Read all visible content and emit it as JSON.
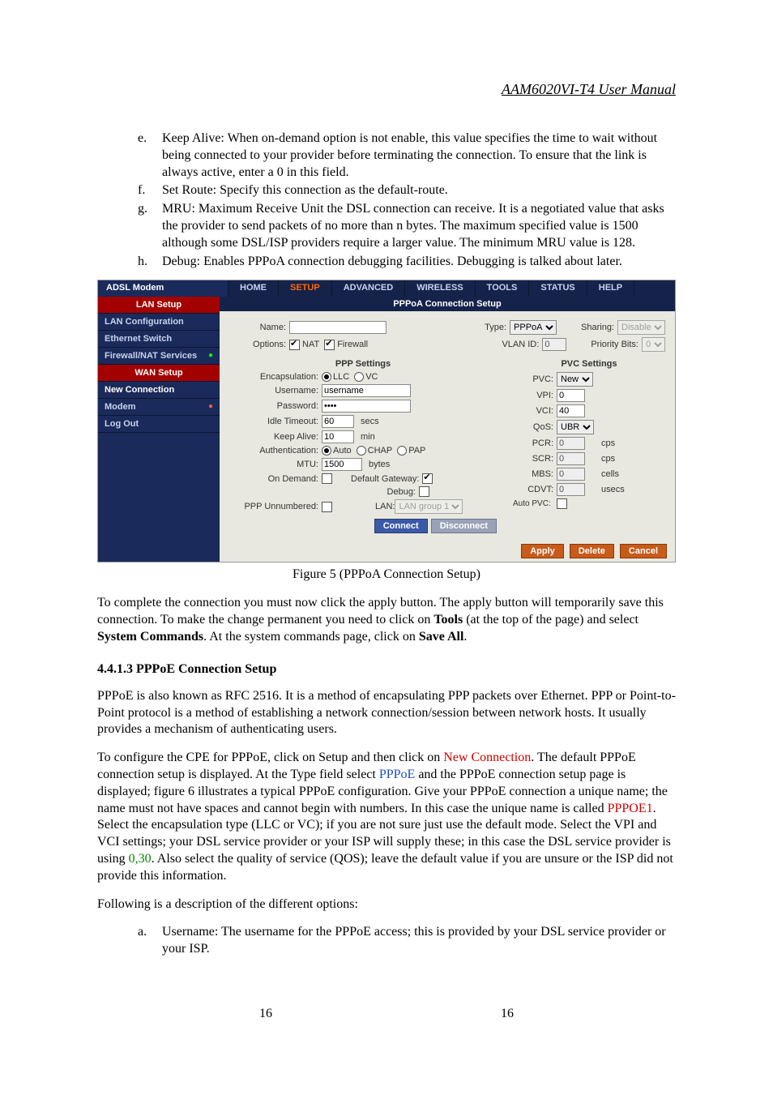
{
  "header": {
    "title": "AAM6020VI-T4 User Manual"
  },
  "list": {
    "e": {
      "marker": "e.",
      "text": "Keep Alive: When on-demand option is not enable, this value specifies the time to wait without being connected to your provider before terminating the connection. To ensure that the link is always active, enter a 0 in this field."
    },
    "f": {
      "marker": "f.",
      "text": "Set Route: Specify this connection as the default-route."
    },
    "g": {
      "marker": "g.",
      "text": "MRU: Maximum Receive Unit the DSL connection can receive. It is a negotiated value that asks the provider to send packets of no more than n bytes. The maximum specified value is 1500 although some DSL/ISP providers require a larger value. The minimum MRU value is 128."
    },
    "h": {
      "marker": "h.",
      "text": "Debug: Enables PPPoA connection debugging facilities.   Debugging is talked about later."
    }
  },
  "fig": {
    "brand": "ADSL Modem",
    "nav": {
      "home": "HOME",
      "setup": "SETUP",
      "advanced": "ADVANCED",
      "wireless": "WIRELESS",
      "tools": "TOOLS",
      "status": "STATUS",
      "help": "HELP"
    },
    "side": {
      "lan_setup": "LAN Setup",
      "lan_config": "LAN Configuration",
      "eth_switch": "Ethernet Switch",
      "fw_nat": "Firewall/NAT Services",
      "wan_setup": "WAN Setup",
      "new_conn": "New Connection",
      "modem": "Modem",
      "logout": "Log Out"
    },
    "main_title": "PPPoA Connection Setup",
    "top": {
      "name_lbl": "Name:",
      "name_val": "",
      "type_lbl": "Type:",
      "type_val": "PPPoA",
      "sharing_lbl": "Sharing:",
      "sharing_val": "Disable",
      "options_lbl": "Options:",
      "nat": "NAT",
      "firewall": "Firewall",
      "vlan_lbl": "VLAN ID:",
      "vlan_val": "0",
      "prio_lbl": "Priority Bits:",
      "prio_val": "0"
    },
    "ppp": {
      "title": "PPP Settings",
      "encap_lbl": "Encapsulation:",
      "llc": "LLC",
      "vc": "VC",
      "user_lbl": "Username:",
      "user_val": "username",
      "pass_lbl": "Password:",
      "pass_val": "••••",
      "idle_lbl": "Idle Timeout:",
      "idle_val": "60",
      "idle_unit": "secs",
      "keep_lbl": "Keep Alive:",
      "keep_val": "10",
      "keep_unit": "min",
      "auth_lbl": "Authentication:",
      "auth_auto": "Auto",
      "auth_chap": "CHAP",
      "auth_pap": "PAP",
      "mtu_lbl": "MTU:",
      "mtu_val": "1500",
      "mtu_unit": "bytes",
      "ond_lbl": "On Demand:",
      "gw_lbl": "Default Gateway:",
      "debug_lbl": "Debug:",
      "pppun_lbl": "PPP Unnumbered:",
      "lan_lbl": "LAN:",
      "lan_val": "LAN group 1"
    },
    "pvc": {
      "title": "PVC Settings",
      "pvc_lbl": "PVC:",
      "pvc_val": "New",
      "vpi_lbl": "VPI:",
      "vpi_val": "0",
      "vci_lbl": "VCI:",
      "vci_val": "40",
      "qos_lbl": "QoS:",
      "qos_val": "UBR",
      "pcr_lbl": "PCR:",
      "pcr_val": "0",
      "pcr_unit": "cps",
      "scr_lbl": "SCR:",
      "scr_val": "0",
      "scr_unit": "cps",
      "mbs_lbl": "MBS:",
      "mbs_val": "0",
      "mbs_unit": "cells",
      "cdvt_lbl": "CDVT:",
      "cdvt_val": "0",
      "cdvt_unit": "usecs",
      "auto_lbl": "Auto PVC:"
    },
    "buttons": {
      "connect": "Connect",
      "disconnect": "Disconnect",
      "apply": "Apply",
      "delete": "Delete",
      "cancel": "Cancel"
    }
  },
  "caption": "Figure 5 (PPPoA Connection Setup)",
  "para1": {
    "t1": "To complete the connection you must now click the apply button.  The apply button will temporarily save this connection. To make the change permanent you need to click on ",
    "b1": "Tools",
    "t2": " (at the top of the page) and select ",
    "b2": "System Commands",
    "t3": ".  At the system commands page, click on ",
    "b3": "Save All",
    "t4": "."
  },
  "sec_head": "4.4.1.3  PPPoE Connection Setup",
  "para2": "PPPoE is also known as RFC 2516. It is a method of encapsulating PPP packets over Ethernet. PPP or Point-to-Point protocol is a method of establishing a network connection/session between network hosts. It usually provides a mechanism of authenticating users.",
  "para3": {
    "t1": "To configure the CPE for PPPoE, click on Setup and then click on ",
    "r1": "New Connection",
    "t2": ".  The default PPPoE connection setup is displayed.  At the Type field select ",
    "bl1": "PPPoE",
    "t3": " and the PPPoE connection setup page is displayed; figure 6 illustrates a typical PPPoE configuration.  Give your PPPoE connection a unique name; the name must not have spaces and cannot begin with numbers.  In this case the unique name is called ",
    "r2": "PPPOE1",
    "t4": ".  Select the encapsulation type (LLC or VC); if you are not sure just use the default mode.  Select the VPI and VCI settings; your DSL service provider or your ISP will supply these; in this case the DSL service provider is using ",
    "g1": "0,30",
    "t5": ".  Also select the quality of service (QOS); leave the default value if you are unsure or the ISP did not provide this information."
  },
  "para4": "Following is a description of the different options:",
  "list2": {
    "a": {
      "marker": "a.",
      "text": "Username: The username for the PPPoE access; this is provided by your DSL service provider or your ISP."
    }
  },
  "pagenum": "16"
}
